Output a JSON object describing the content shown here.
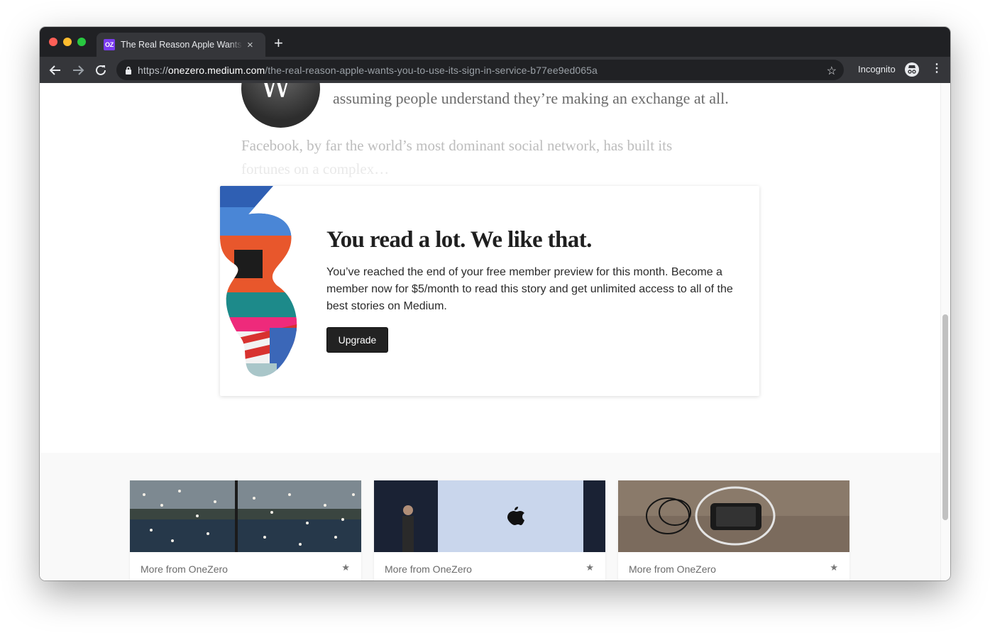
{
  "browser": {
    "tab_title": "The Real Reason Apple Wants You to Use Its Sign-In Service",
    "tab_favicon_text": "OZ",
    "new_tab_glyph": "+",
    "close_glyph": "×",
    "url_scheme": "https://",
    "url_host": "onezero.medium.com",
    "url_path": "/the-real-reason-apple-wants-you-to-use-its-sign-in-service-b77ee9ed065a",
    "incognito_label": "Incognito",
    "colors": {
      "tabstrip": "#202124",
      "toolbar": "#35363a",
      "favicon": "#7b3cf0"
    }
  },
  "article": {
    "avatar_initials": "W",
    "quote_line": "assuming people understand they’re making an exchange at all.",
    "excerpt_line1": "Facebook, by far the world’s most dominant social network, has built its",
    "excerpt_line2": "fortunes on a complex…"
  },
  "paywall": {
    "title": "You read a lot. We like that.",
    "body": "You’ve reached the end of your free member preview for this month. Become a member now for $5/month to read this story and get unlimited access to all of the best stories on Medium.",
    "button_label": "Upgrade"
  },
  "more_from": {
    "cards": [
      {
        "label": "More from OneZero",
        "image": "birds-over-water"
      },
      {
        "label": "More from OneZero",
        "image": "apple-keynote"
      },
      {
        "label": "More from OneZero",
        "image": "phone-and-earbuds"
      }
    ]
  }
}
